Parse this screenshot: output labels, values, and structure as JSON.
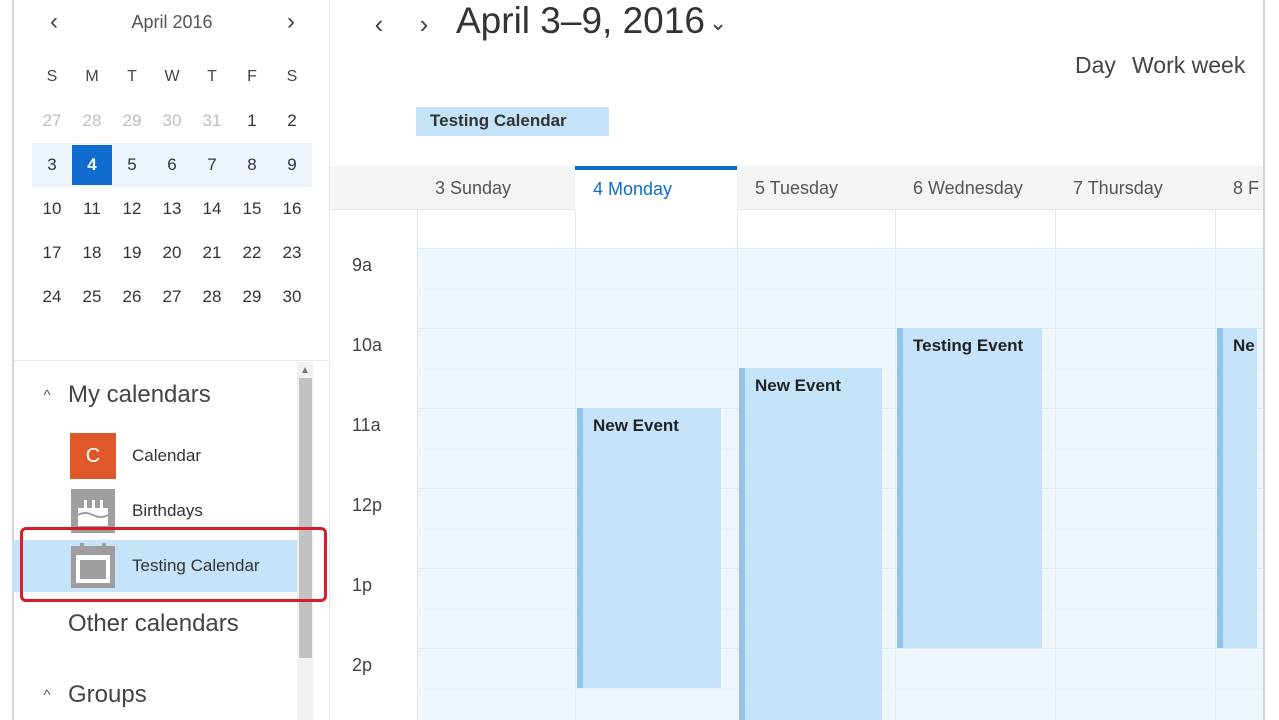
{
  "mini_calendar": {
    "month_label": "April 2016",
    "prev_icon": "‹",
    "next_icon": "›",
    "weekdays": [
      "S",
      "M",
      "T",
      "W",
      "T",
      "F",
      "S"
    ],
    "weeks": [
      [
        "27",
        "28",
        "29",
        "30",
        "31",
        "1",
        "2"
      ],
      [
        "3",
        "4",
        "5",
        "6",
        "7",
        "8",
        "9"
      ],
      [
        "10",
        "11",
        "12",
        "13",
        "14",
        "15",
        "16"
      ],
      [
        "17",
        "18",
        "19",
        "20",
        "21",
        "22",
        "23"
      ],
      [
        "24",
        "25",
        "26",
        "27",
        "28",
        "29",
        "30"
      ]
    ],
    "today": "4"
  },
  "sidebar": {
    "my_calendars_label": "My calendars",
    "calendars": [
      {
        "label": "Calendar",
        "icon": "C"
      },
      {
        "label": "Birthdays",
        "icon": "cake-icon"
      },
      {
        "label": "Testing Calendar",
        "icon": "calendar-icon"
      }
    ],
    "other_calendars_label": "Other calendars",
    "groups_label": "Groups",
    "collapse_icon": "^"
  },
  "header": {
    "title": "April 3–9, 2016",
    "dropdown_icon": "⌄",
    "prev_icon": "‹",
    "next_icon": "›",
    "views": {
      "day": "Day",
      "work_week": "Work week"
    }
  },
  "allday": {
    "label": "Testing Calendar"
  },
  "days": [
    "3 Sunday",
    "4 Monday",
    "5 Tuesday",
    "6 Wednesday",
    "7 Thursday",
    "8 F"
  ],
  "times": [
    "9a",
    "10a",
    "11a",
    "12p",
    "1p",
    "2p"
  ],
  "events": [
    {
      "title": "New Event"
    },
    {
      "title": "New Event"
    },
    {
      "title": "Testing Event"
    },
    {
      "title": "Ne"
    }
  ],
  "colors": {
    "accent": "#0f6cce",
    "event_fill": "#c5e4f9",
    "event_bar": "#92c2ec",
    "calendar_icon": "#e0582a",
    "highlight_border": "#d81b26"
  }
}
